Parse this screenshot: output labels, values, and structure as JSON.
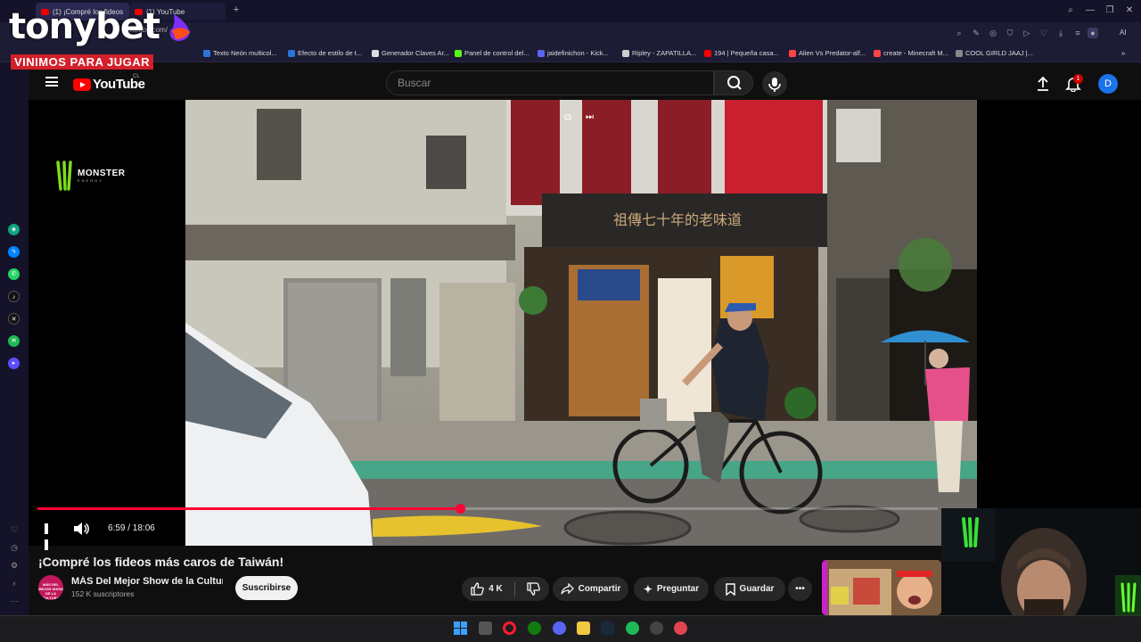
{
  "browser": {
    "tabs": [
      {
        "label": "(1) ¡Compré los fideos"
      },
      {
        "label": "(1) YouTube"
      }
    ],
    "url": "youtube.com/",
    "bookmarks": [
      {
        "label": "Texto Neón multicol...",
        "color": "#2b74d8"
      },
      {
        "label": "Efecto de estilo de t...",
        "color": "#2b74d8"
      },
      {
        "label": "Generador Claves Ar...",
        "color": "#dddddd"
      },
      {
        "label": "Panel de control del...",
        "color": "#53fc18"
      },
      {
        "label": "jaidefinichon - Kick...",
        "color": "#5865f2"
      },
      {
        "label": "Ripley - ZAPATILLA...",
        "color": "#cccccc"
      },
      {
        "label": "194 | Pequeña casa...",
        "color": "#ff0000"
      },
      {
        "label": "Alien Vs Predator-alf...",
        "color": "#ff4444"
      },
      {
        "label": "create - Minecraft M...",
        "color": "#ff4444"
      },
      {
        "label": "COOL GIRLD JAAJ |...",
        "color": "#888888"
      }
    ],
    "addr_right": "AI"
  },
  "overlay": {
    "brand": "tonybet",
    "tagline": "VINIMOS PARA JUGAR"
  },
  "youtube": {
    "logo_text": "YouTube",
    "region": "CL",
    "search_placeholder": "Buscar",
    "notifications": "1",
    "avatar_letter": "D"
  },
  "player": {
    "sponsor": "MONSTER",
    "sponsor_sub": "ENERGY",
    "current_time": "6:59",
    "duration": "18:06",
    "time_display": "6:59 / 18:06",
    "progress_fraction": 0.469
  },
  "video": {
    "title": "¡Compré los fideos más caros de Taiwán!",
    "channel_name": "MÁS Del Mejor Show de la Cultura",
    "channel_avatar_text": "MÁS DEL MEJOR SHOW DE LA CULTURA",
    "subscribers": "152 K suscriptores",
    "subscribe_label": "Suscribirse",
    "likes": "4 K",
    "share_label": "Compartir",
    "ask_label": "Preguntar",
    "save_label": "Guardar"
  },
  "colors": {
    "accent": "#ff0033",
    "subscribe_bg": "#f1f1f1"
  }
}
